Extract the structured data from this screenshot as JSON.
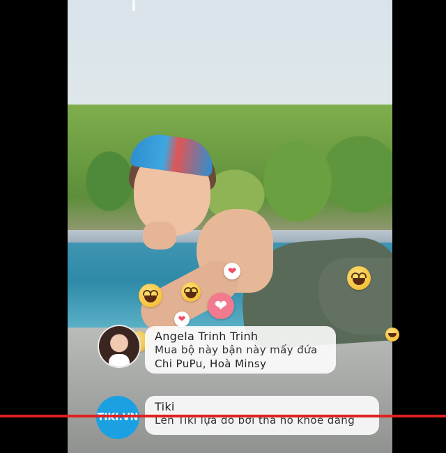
{
  "comments": [
    {
      "name": "Angela Trinh Trinh",
      "text": "Mua bộ này bận này mấy đứa",
      "tags": "Chi PuPu, Hoà Minsy"
    },
    {
      "name": "Tiki",
      "text": "Lên Tiki lựa đồ bơi tha hồ khoe dáng",
      "avatar_text": "TIKI.VN"
    }
  ],
  "reactions": [
    "laugh-emoji",
    "heart-icon",
    "laugh-emoji",
    "heart-icon",
    "laugh-emoji",
    "heart-icon",
    "laugh-emoji"
  ],
  "colors": {
    "heart": "#ef4d6a",
    "overlay_line": "#e02020",
    "tiki_brand": "#1ba1e2"
  }
}
